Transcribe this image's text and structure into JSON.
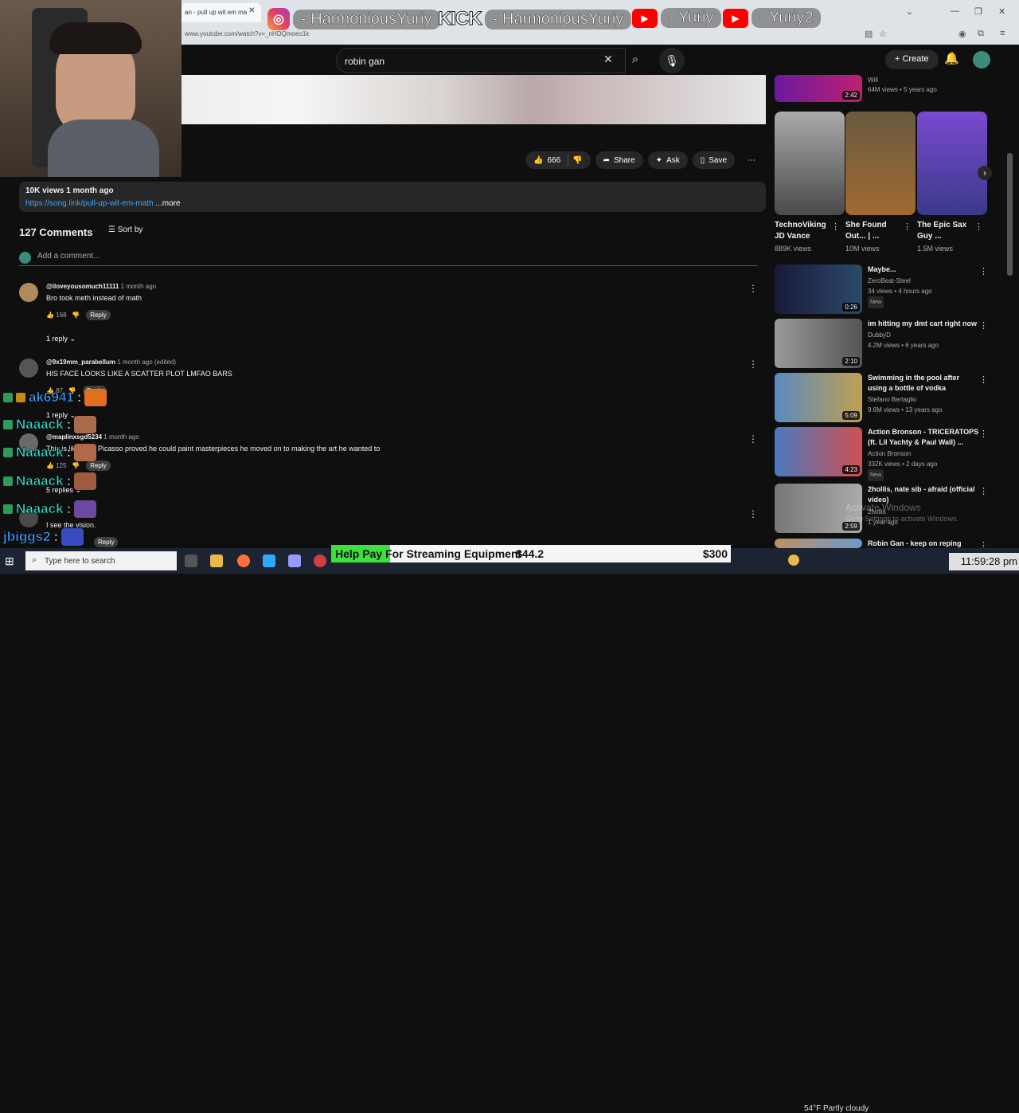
{
  "browser": {
    "tab_title": "an - pull up wit em ma",
    "url": "www.youtube.com/watch?v=_nHDQmoeo1k"
  },
  "social": {
    "instagram": "- HarmoniousYuriy",
    "kick_logo": "KICK",
    "kick": "- HarmoniousYuriy",
    "youtube1": "- Yuriy",
    "youtube2": "- Yuriy2"
  },
  "youtube": {
    "search_value": "robin gan",
    "create_label": "Create"
  },
  "video": {
    "likes": "666",
    "share_label": "Share",
    "ask_label": "Ask",
    "save_label": "Save",
    "views_date": "10K views  1 month ago",
    "link": "https://song.link/pull-up-wit-em-math",
    "more_label": "...more"
  },
  "comments": {
    "count_label": "127 Comments",
    "sort_label": "Sort by",
    "add_placeholder": "Add a comment...",
    "items": [
      {
        "user": "@iloveyousomuch11111",
        "ago": "1 month ago",
        "text": "Bro took meth instead of math",
        "likes": "168",
        "reply_label": "Reply",
        "replies_label": "1 reply"
      },
      {
        "user": "@9x19mm_parabellum",
        "ago": "1 month ago (edited)",
        "text": "HIS FACE LOOKS LIKE A SCATTER PLOT LMFAO BARS",
        "likes": "87",
        "reply_label": "Reply",
        "replies_label": "1 reply"
      },
      {
        "user": "@maplinxsgd5234",
        "ago": "1 month ago",
        "text": "This is like after Picasso proved he could paint masterpieces he moved on to making the art he wanted to",
        "likes": "125",
        "reply_label": "Reply",
        "replies_label": "5 replies"
      },
      {
        "user": "",
        "ago": "",
        "text": "I see the vision.",
        "likes": "",
        "reply_label": "Reply",
        "replies_label": ""
      }
    ]
  },
  "chat": [
    {
      "name": "ak6941",
      "suffix": ":",
      "color": "#3aa0ff"
    },
    {
      "name": "Naaack",
      "suffix": ":",
      "color": "#3ad6c8"
    },
    {
      "name": "Naaack",
      "suffix": ":",
      "color": "#3ad6c8"
    },
    {
      "name": "Naaack",
      "suffix": ":",
      "color": "#3ad6c8"
    },
    {
      "name": "Naaack",
      "suffix": ":",
      "color": "#3ad6c8"
    },
    {
      "name": "jbiggs2",
      "suffix": ":",
      "color": "#3aa0ff"
    }
  ],
  "sidebar": {
    "top": {
      "channel": "Will",
      "meta": "64M views • 5 years ago",
      "duration": "2:42"
    },
    "shorts": [
      {
        "title": "TechnoViking JD Vance",
        "views": "889K views"
      },
      {
        "title": "She Found Out... | ...",
        "views": "10M views"
      },
      {
        "title": "The Epic Sax Guy ...",
        "views": "1.5M views"
      }
    ],
    "videos": [
      {
        "title": "Maybe...",
        "channel": "ZeroBeat-Steel",
        "meta": "34 views • 4 hours ago",
        "badge": "New",
        "duration": "0:26"
      },
      {
        "title": "im hitting my dmt cart right now",
        "channel": "DubbyD",
        "meta": "4.2M views • 6 years ago",
        "badge": "",
        "duration": "2:10"
      },
      {
        "title": "Swimming in the pool after using a bottle of vodka",
        "channel": "Stefano Bertaglio",
        "meta": "9.6M views • 13 years ago",
        "badge": "",
        "duration": "5:09"
      },
      {
        "title": "Action Bronson - TRICERATOPS (ft. Lil Yachty & Paul Wall) ...",
        "channel": "Action Bronson",
        "meta": "332K views • 2 days ago",
        "badge": "New",
        "duration": "4:23"
      },
      {
        "title": "2hollis, nate sib - afraid (official video)",
        "channel": "2hollis",
        "meta": "1 year ago",
        "badge": "",
        "duration": "2:59"
      },
      {
        "title": "Robin Gan - keep on reping",
        "channel": "",
        "meta": "",
        "badge": "",
        "duration": ""
      }
    ]
  },
  "overlay": {
    "activate_title": "Activate Windows",
    "activate_sub": "Go to Settings to activate Windows.",
    "donation_label": "Help Pay For Streaming Equipment",
    "donation_current": "$44.2",
    "donation_goal": "$300",
    "donation_progress": 0.147
  },
  "taskbar": {
    "search_placeholder": "Type here to search",
    "weather": "54°F  Partly cloudy",
    "time": "11:59:28 pm"
  }
}
